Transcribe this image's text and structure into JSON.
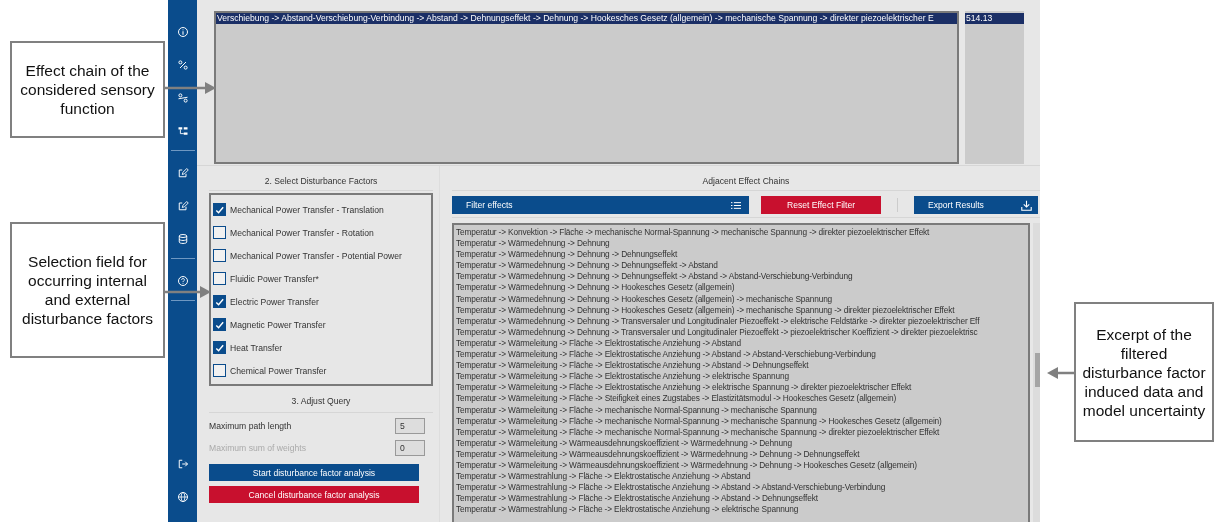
{
  "callouts": [
    {
      "text": "Effect chain of the considered sensory function"
    },
    {
      "text": "Selection field for occurring internal and external disturbance factors"
    },
    {
      "text": "Excerpt of the filtered disturbance factor induced data and model uncertainty"
    }
  ],
  "effect_chain": {
    "rows": [
      {
        "text": "Verschiebung -> Abstand-Verschiebung-Verbindung -> Abstand -> Dehnungseffekt -> Dehnung -> Hookesches Gesetz (allgemein) -> mechanische Spannung -> direkter piezoelektrischer E",
        "selected": true
      }
    ],
    "values": [
      {
        "text": "514.13",
        "selected": true
      }
    ]
  },
  "disturbance": {
    "title": "2. Select Disturbance Factors",
    "factors": [
      {
        "label": "Mechanical Power Transfer - Translation",
        "checked": true
      },
      {
        "label": "Mechanical Power Transfer - Rotation",
        "checked": false
      },
      {
        "label": "Mechanical Power Transfer - Potential Power",
        "checked": false
      },
      {
        "label": "Fluidic Power Transfer*",
        "checked": false
      },
      {
        "label": "Electric Power Transfer",
        "checked": true
      },
      {
        "label": "Magnetic Power Transfer",
        "checked": true
      },
      {
        "label": "Heat Transfer",
        "checked": true
      },
      {
        "label": "Chemical Power Transfer",
        "checked": false
      }
    ]
  },
  "query": {
    "title": "3. Adjust Query",
    "fields": [
      {
        "label": "Maximum path length",
        "value": "5",
        "disabled": false
      },
      {
        "label": "Maximum sum of weights",
        "value": "0",
        "disabled": true
      }
    ],
    "buttons": [
      {
        "label": "Start disturbance factor analysis",
        "kind": "primary"
      },
      {
        "label": "Cancel disturbance factor analysis",
        "kind": "danger"
      }
    ]
  },
  "adjacent": {
    "title": "Adjacent Effect Chains",
    "filter": {
      "label": "Filter effects"
    },
    "buttons": [
      {
        "label": "Reset Effect Filter",
        "kind": "danger"
      },
      {
        "label": "Export Results",
        "kind": "export"
      }
    ],
    "chains": [
      "Temperatur -> Konvektion -> Fläche -> mechanische Normal-Spannung -> mechanische Spannung -> direkter piezoelektrischer Effekt",
      "Temperatur -> Wärmedehnung -> Dehnung",
      "Temperatur -> Wärmedehnung -> Dehnung -> Dehnungseffekt",
      "Temperatur -> Wärmedehnung -> Dehnung -> Dehnungseffekt -> Abstand",
      "Temperatur -> Wärmedehnung -> Dehnung -> Dehnungseffekt -> Abstand -> Abstand-Verschiebung-Verbindung",
      "Temperatur -> Wärmedehnung -> Dehnung -> Hookesches Gesetz (allgemein)",
      "Temperatur -> Wärmedehnung -> Dehnung -> Hookesches Gesetz (allgemein) -> mechanische Spannung",
      "Temperatur -> Wärmedehnung -> Dehnung -> Hookesches Gesetz (allgemein) -> mechanische Spannung -> direkter piezoelektrischer Effekt",
      "Temperatur -> Wärmedehnung -> Dehnung -> Transversaler und Longitudinaler Piezoeffekt -> elektrische Feldstärke -> direkter piezoelektrischer Eff",
      "Temperatur -> Wärmedehnung -> Dehnung -> Transversaler und Longitudinaler Piezoeffekt -> piezoelektrischer Koeffizient -> direkter piezoelektrisc",
      "Temperatur -> Wärmeleitung -> Fläche -> Elektrostatische  Anziehung -> Abstand",
      "Temperatur -> Wärmeleitung -> Fläche -> Elektrostatische  Anziehung -> Abstand -> Abstand-Verschiebung-Verbindung",
      "Temperatur -> Wärmeleitung -> Fläche -> Elektrostatische  Anziehung -> Abstand -> Dehnungseffekt",
      "Temperatur -> Wärmeleitung -> Fläche -> Elektrostatische  Anziehung -> elektrische Spannung",
      "Temperatur -> Wärmeleitung -> Fläche -> Elektrostatische  Anziehung -> elektrische Spannung -> direkter piezoelektrischer Effekt",
      "Temperatur -> Wärmeleitung -> Fläche -> Steifigkeit eines Zugstabes -> Elastizitätsmodul -> Hookesches Gesetz (allgemein)",
      "Temperatur -> Wärmeleitung -> Fläche -> mechanische Normal-Spannung -> mechanische Spannung",
      "Temperatur -> Wärmeleitung -> Fläche -> mechanische Normal-Spannung -> mechanische Spannung -> Hookesches Gesetz (allgemein)",
      "Temperatur -> Wärmeleitung -> Fläche -> mechanische Normal-Spannung -> mechanische Spannung -> direkter piezoelektrischer Effekt",
      "Temperatur -> Wärmeleitung -> Wärmeausdehnungskoeffizient -> Wärmedehnung -> Dehnung",
      "Temperatur -> Wärmeleitung -> Wärmeausdehnungskoeffizient -> Wärmedehnung -> Dehnung -> Dehnungseffekt",
      "Temperatur -> Wärmeleitung -> Wärmeausdehnungskoeffizient -> Wärmedehnung -> Dehnung -> Hookesches Gesetz (allgemein)",
      "Temperatur -> Wärmestrahlung -> Fläche -> Elektrostatische  Anziehung -> Abstand",
      "Temperatur -> Wärmestrahlung -> Fläche -> Elektrostatische  Anziehung -> Abstand -> Abstand-Verschiebung-Verbindung",
      "Temperatur -> Wärmestrahlung -> Fläche -> Elektrostatische  Anziehung -> Abstand -> Dehnungseffekt",
      "Temperatur -> Wärmestrahlung -> Fläche -> Elektrostatische  Anziehung -> elektrische Spannung"
    ]
  }
}
